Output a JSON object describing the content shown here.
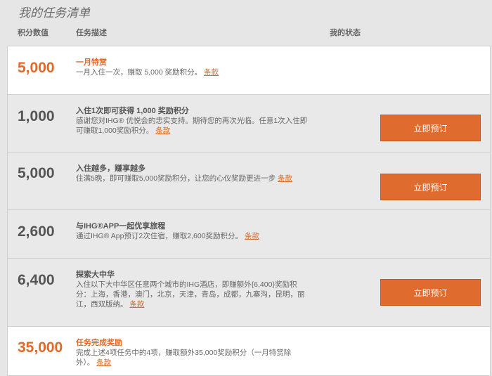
{
  "page": {
    "title": "我的任务清单",
    "columns": {
      "points": "积分数值",
      "description": "任务描述",
      "status": "我的状态"
    }
  },
  "tasks": [
    {
      "points": "5,000",
      "title": "一月特赏",
      "text": "一月入住一次，赚取 5,000 奖励积分。",
      "link": "条款",
      "has_button": false
    },
    {
      "points": "1,000",
      "title": "入住1次即可获得 1,000 奖励积分",
      "text": "感谢您对IHG® 优悦会的忠实支持。期待您的再次光临。任意1次入住即可赚取1,000奖励积分。",
      "link": "条款",
      "has_button": true,
      "button": "立即预订"
    },
    {
      "points": "5,000",
      "title": "入住越多，赚享越多",
      "text": "住满5晚，即可赚取5,000奖励积分，让您的心仪奖励更进一步",
      "link": "条款",
      "has_button": true,
      "button": "立即预订"
    },
    {
      "points": "2,600",
      "title": "与IHG®APP一起优享旅程",
      "text": "通过IHG® App预订2次住宿，赚取2,600奖励积分。",
      "link": "条款",
      "has_button": false
    },
    {
      "points": "6,400",
      "title": "探索大中华",
      "text": "入住以下大中华区任意两个城市的IHG酒店，即赚额外{6,400}奖励积分：上海，香港，澳门，北京，天津，青岛，成都，九寨沟，昆明，丽江，西双版纳。",
      "link": "条款",
      "has_button": true,
      "button": "立即预订"
    },
    {
      "points": "35,000",
      "title": "任务完成奖励",
      "text": "完成上述4项任务中的4项，赚取额外35,000奖励积分（一月特赏除外）。",
      "link": "条款",
      "has_button": false
    }
  ]
}
